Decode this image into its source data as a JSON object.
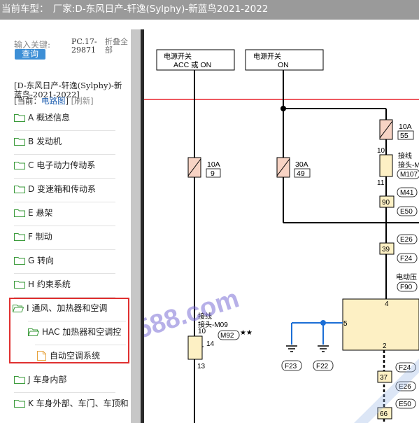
{
  "window": {
    "title_prefix": "当前车型：",
    "title": "厂家:D-东风日产-轩逸(Sylphy)-新蓝鸟2021-2022"
  },
  "search": {
    "keyword_label": "输入关键:",
    "query_button": "查询",
    "pc_label": "PC.17-29871",
    "fold_label": "折叠全部"
  },
  "model": {
    "title": "[D-东风日产-轩逸(Sylphy)-新蓝鸟-2021-2022]",
    "current_prefix": "[当前：",
    "current_link": "电路图",
    "current_suffix": "]",
    "refresh": "[刷新]"
  },
  "tree": {
    "items": [
      {
        "label": "A 概述信息"
      },
      {
        "label": "B 发动机"
      },
      {
        "label": "C 电子动力传动系"
      },
      {
        "label": "D 变速箱和传动系"
      },
      {
        "label": "E 悬架"
      },
      {
        "label": "F 制动"
      },
      {
        "label": "G 转向"
      },
      {
        "label": "H 约束系统"
      },
      {
        "label": "I 通风、加热器和空调"
      },
      {
        "label": "HAC 加热器和空调控"
      },
      {
        "label": "自动空调系统"
      },
      {
        "label": "J 车身内部"
      },
      {
        "label": "K 车身外部、车门、车顶和"
      }
    ]
  },
  "diagram": {
    "watermark": "588.com",
    "box1": {
      "line1": "电源开关",
      "line2": "ACC 或 ON"
    },
    "box2": {
      "line1": "电源开关",
      "line2": "ON"
    },
    "fuse1": {
      "amp": "10A",
      "num": "9"
    },
    "fuse2": {
      "amp": "30A",
      "num": "49"
    },
    "fuse3": {
      "amp": "10A",
      "num": "55"
    },
    "splice1": {
      "label1": "接线",
      "label2": "接头-M09",
      "conn": "M92",
      "stars": "★★",
      "pin_top": "10",
      "pin_right": "14",
      "pin_bottom": "13"
    },
    "splice2": {
      "label1": "接线",
      "label2": "接头-M",
      "conn": "M107",
      "pin_top": "10",
      "pin_bottom": "11"
    },
    "conns": [
      "M41",
      "90",
      "E50",
      "E26",
      "39",
      "F24",
      "F90",
      "F24",
      "37",
      "E26",
      "E50",
      "66"
    ],
    "motor_label": "电动压",
    "module": {
      "pin_top": "4",
      "pin_left": "5",
      "pin_bottom": "2"
    },
    "grounds": [
      "F23",
      "F22"
    ]
  }
}
